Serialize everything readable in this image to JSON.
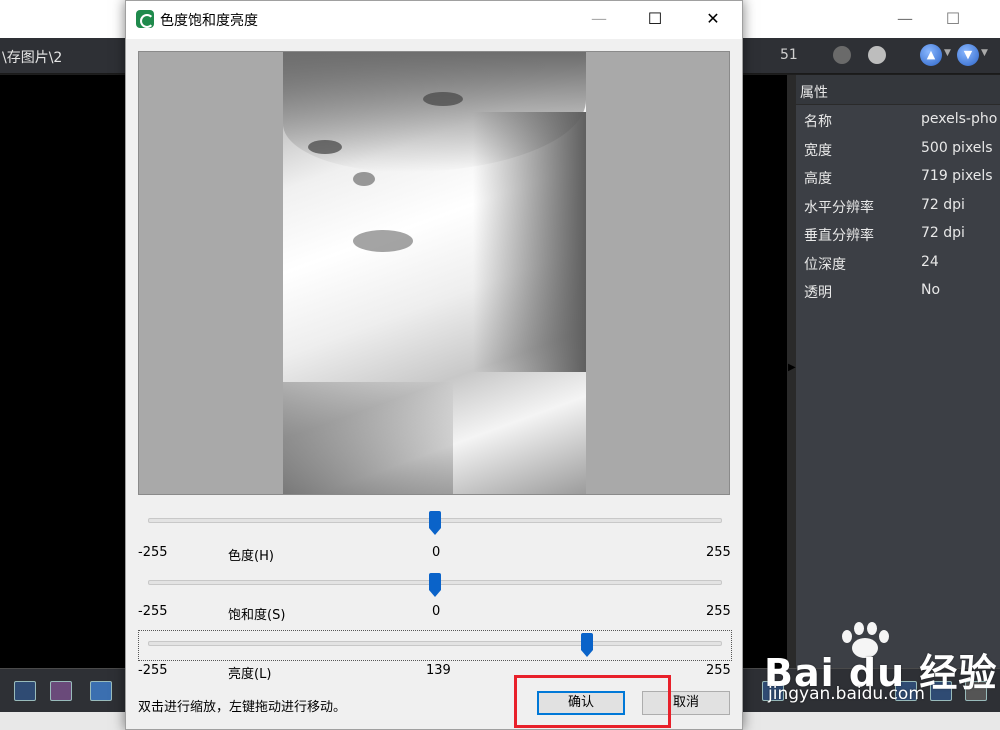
{
  "background_app": {
    "path": "\\存图片\\2",
    "count": "51",
    "window_controls": {
      "minimize": "—",
      "maximize": "☐"
    },
    "properties": {
      "header": "属性",
      "rows": [
        {
          "key": "名称",
          "value": "pexels-pho"
        },
        {
          "key": "宽度",
          "value": "500 pixels"
        },
        {
          "key": "高度",
          "value": "719 pixels"
        },
        {
          "key": "水平分辨率",
          "value": "72 dpi"
        },
        {
          "key": "垂直分辨率",
          "value": "72 dpi"
        },
        {
          "key": "位深度",
          "value": "24"
        },
        {
          "key": "透明",
          "value": "No"
        }
      ]
    }
  },
  "dialog": {
    "title": "色度饱和度亮度",
    "window_controls": {
      "minimize": "—",
      "maximize": "☐",
      "close": "✕"
    },
    "sliders": [
      {
        "label": "色度(H)",
        "min": "-255",
        "max": "255",
        "value": 0
      },
      {
        "label": "饱和度(S)",
        "min": "-255",
        "max": "255",
        "value": 0
      },
      {
        "label": "亮度(L)",
        "min": "-255",
        "max": "255",
        "value": 139
      }
    ],
    "hint": "双击进行缩放，左键拖动进行移动。",
    "ok_label": "确认",
    "cancel_label": "取消"
  },
  "watermark": {
    "brand": "Bai du 经验",
    "url": "jingyan.baidu.com"
  },
  "colors": {
    "accent": "#0a63c9",
    "highlight": "#e8202a",
    "panel": "#3c3f45"
  }
}
